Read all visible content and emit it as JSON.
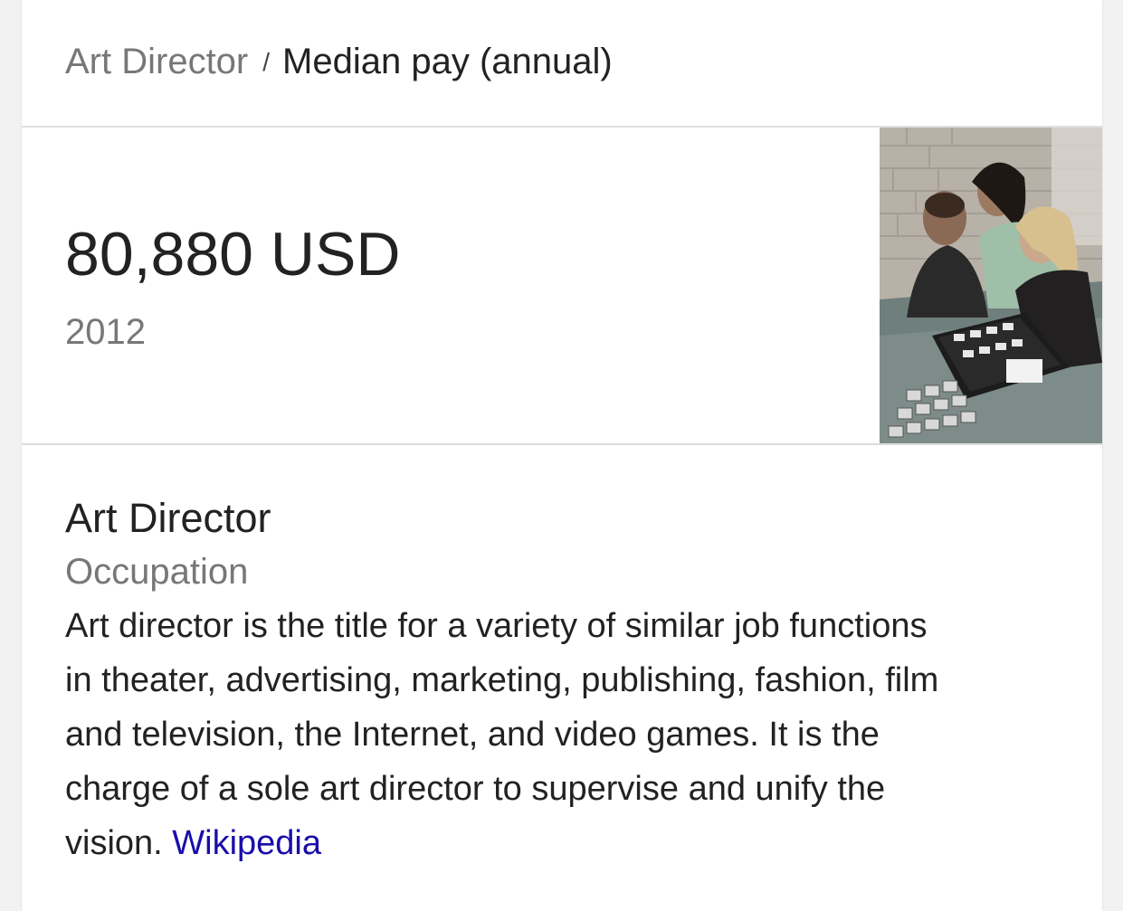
{
  "breadcrumb": {
    "parent": "Art Director",
    "separator": "/",
    "current": "Median pay (annual)"
  },
  "pay": {
    "value": "80,880 USD",
    "year": "2012"
  },
  "entity": {
    "title": "Art Director",
    "type": "Occupation",
    "description_lines": [
      "Art director is the title for a variety of similar job functions",
      "in theater, advertising, marketing, publishing, fashion, film",
      "and television, the Internet, and video games. It is the",
      "charge of a sole art director to supervise and unify the",
      "vision."
    ],
    "source_link": "Wikipedia"
  },
  "colors": {
    "link": "#1a0dab",
    "primary_text": "#222222",
    "secondary_text": "#777777"
  }
}
